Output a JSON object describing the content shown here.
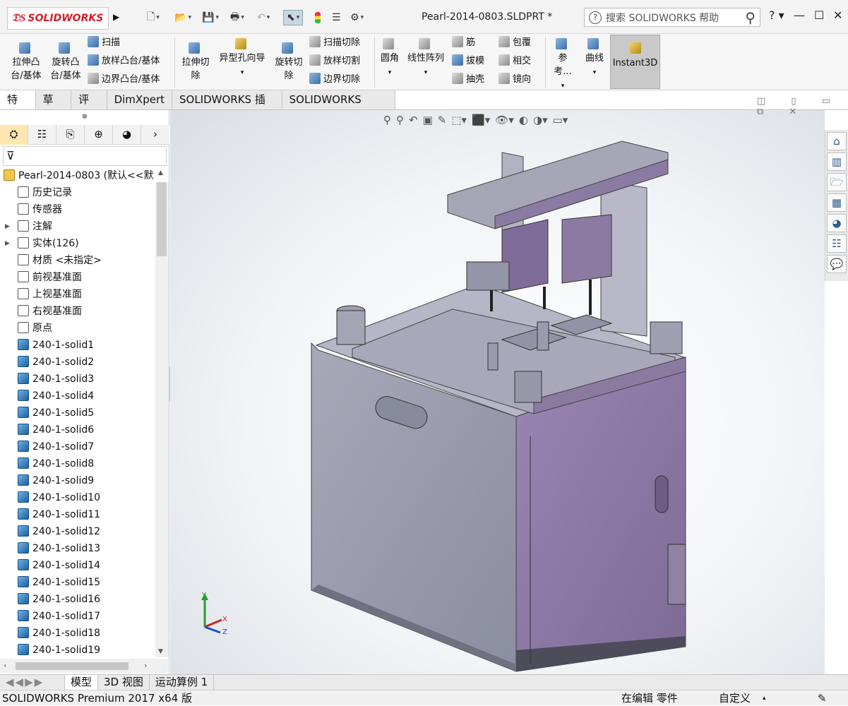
{
  "titlebar": {
    "logo_text": "SOLIDWORKS",
    "document_title": "Pearl-2014-0803.SLDPRT *",
    "search_placeholder": "搜索 SOLIDWORKS 帮助",
    "help": "?"
  },
  "commands": {
    "extrude_boss": [
      "拉伸凸",
      "台/基体"
    ],
    "revolve_boss": [
      "旋转凸",
      "台/基体"
    ],
    "sweep": "扫描",
    "loft_boss": "放样凸台/基体",
    "boundary_boss": "边界凸台/基体",
    "extrude_cut": [
      "拉伸切",
      "除"
    ],
    "hole_wizard": "异型孔向导",
    "revolve_cut": [
      "旋转切",
      "除"
    ],
    "swept_cut": "扫描切除",
    "lofted_cut": "放样切割",
    "boundary_cut": "边界切除",
    "fillet": "圆角",
    "linear_pattern": "线性阵列",
    "rib": "筋",
    "draft": "拔模",
    "shell": "抽壳",
    "wrap": "包覆",
    "intersect": "相交",
    "mirror": "镜向",
    "reference": "参考...",
    "curves": "曲线",
    "instant3d": "Instant3D"
  },
  "tabs": [
    "特征",
    "草图",
    "评估",
    "DimXpert",
    "SOLIDWORKS 插件",
    "SOLIDWORKS MBD"
  ],
  "tree": {
    "root": "Pearl-2014-0803  (默认<<默",
    "fixed_items": [
      "历史记录",
      "传感器",
      "注解",
      "实体(126)",
      "材质 <未指定>",
      "前视基准面",
      "上视基准面",
      "右视基准面",
      "原点"
    ],
    "solids": [
      "240-1-solid1",
      "240-1-solid2",
      "240-1-solid3",
      "240-1-solid4",
      "240-1-solid5",
      "240-1-solid6",
      "240-1-solid7",
      "240-1-solid8",
      "240-1-solid9",
      "240-1-solid10",
      "240-1-solid11",
      "240-1-solid12",
      "240-1-solid13",
      "240-1-solid14",
      "240-1-solid15",
      "240-1-solid16",
      "240-1-solid17",
      "240-1-solid18",
      "240-1-solid19"
    ]
  },
  "bottom_tabs": [
    "模型",
    "3D 视图",
    "运动算例 1"
  ],
  "status": {
    "product": "SOLIDWORKS Premium 2017 x64 版",
    "mode": "在编辑 零件",
    "units": "自定义"
  },
  "triad": {
    "x": "X",
    "y": "Y",
    "z": "Z"
  },
  "colors": {
    "accent_red": "#d21f2b",
    "solid_blue": "#1c5f9c",
    "model_purple": "#8e7ea3"
  }
}
